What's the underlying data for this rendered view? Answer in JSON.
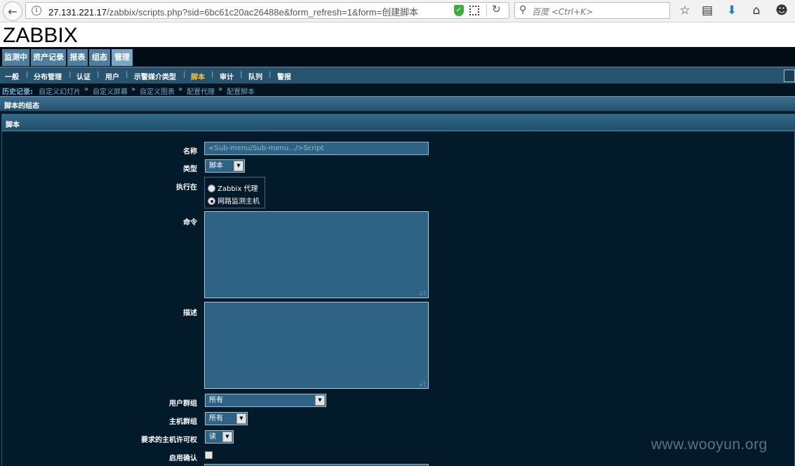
{
  "browser": {
    "url_host": "27.131.221.17",
    "url_path": "/zabbix/scripts.php?sid=6bc61c20ac26488e&form_refresh=1&form=创建脚本",
    "search_placeholder": "百度 <Ctrl+K>"
  },
  "header": {
    "logo": "ZABBIX"
  },
  "main_menu": [
    "监测中",
    "资产记录",
    "报表",
    "组态",
    "管理"
  ],
  "sub_menu": [
    "一般",
    "分布管理",
    "认证",
    "用户",
    "示警媒介类型",
    "脚本",
    "审计",
    "队列",
    "警报"
  ],
  "sub_menu_active": "脚本",
  "history": {
    "label": "历史记录:",
    "links": [
      "自定义幻灯片",
      "自定义屏幕",
      "自定义图表",
      "配置代理",
      "配置脚本"
    ],
    "separator": "»"
  },
  "section_title": "脚本的组态",
  "form": {
    "title": "脚本",
    "name_label": "名称",
    "name_placeholder": "<Sub-menu/Sub-menu.../>Script",
    "type_label": "类型",
    "type_value": "脚本",
    "execute_label": "执行在",
    "execute_options": [
      "Zabbix 代理",
      "网路监测主机"
    ],
    "execute_selected": "网路监测主机",
    "command_label": "命令",
    "description_label": "描述",
    "user_group_label": "用户群组",
    "user_group_value": "所有",
    "host_group_label": "主机群组",
    "host_group_value": "所有",
    "host_access_label": "要求的主机许可权",
    "host_access_value": "读",
    "confirm_label": "启用确认"
  },
  "watermark": "www.wooyun.org"
}
